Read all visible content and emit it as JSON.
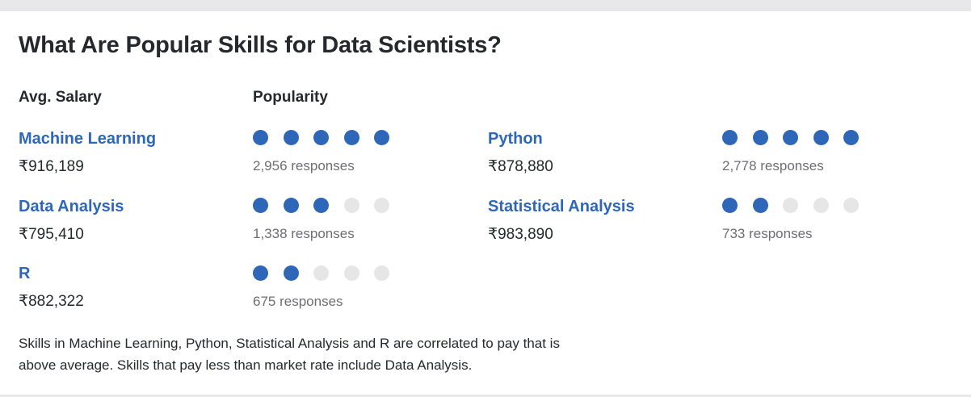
{
  "title": "What Are Popular Skills for Data Scientists?",
  "headers": {
    "salary": "Avg. Salary",
    "popularity": "Popularity"
  },
  "skills": [
    {
      "name": "Machine Learning",
      "salary": "₹916,189",
      "popularity": 5,
      "max": 5,
      "responses": "2,956 responses"
    },
    {
      "name": "Python",
      "salary": "₹878,880",
      "popularity": 5,
      "max": 5,
      "responses": "2,778 responses"
    },
    {
      "name": "Data Analysis",
      "salary": "₹795,410",
      "popularity": 3,
      "max": 5,
      "responses": "1,338 responses"
    },
    {
      "name": "Statistical Analysis",
      "salary": "₹983,890",
      "popularity": 2,
      "max": 5,
      "responses": "733 responses"
    },
    {
      "name": "R",
      "salary": "₹882,322",
      "popularity": 2,
      "max": 5,
      "responses": "675 responses"
    }
  ],
  "summary": "Skills in Machine Learning, Python, Statistical Analysis and R are correlated to pay that is above average. Skills that pay less than market rate include Data Analysis.",
  "colors": {
    "accent": "#2e66b8",
    "dot_empty": "#e6e6e6",
    "text": "#25282c",
    "muted": "#6e6e72"
  }
}
